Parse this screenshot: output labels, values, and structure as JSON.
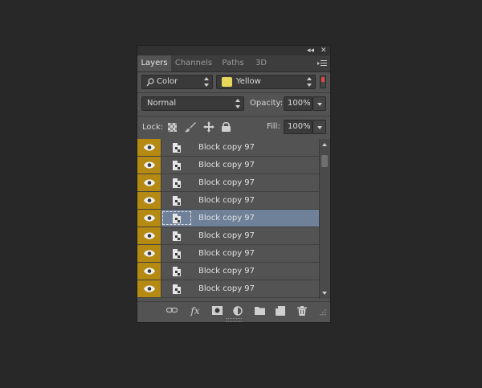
{
  "window": {
    "collapse_glyph": "◂◂",
    "close_glyph": "✕"
  },
  "tabs": [
    {
      "label": "Layers",
      "active": true
    },
    {
      "label": "Channels",
      "active": false
    },
    {
      "label": "Paths",
      "active": false
    },
    {
      "label": "3D",
      "active": false
    }
  ],
  "filter": {
    "kind_value": "Color",
    "color_value": "Yellow",
    "swatch_color": "#e8d65a",
    "toggle_color": "#e04848"
  },
  "blend": {
    "mode_value": "Normal",
    "opacity_label": "Opacity:",
    "opacity_value": "100%"
  },
  "lock": {
    "label": "Lock:",
    "fill_label": "Fill:",
    "fill_value": "100%"
  },
  "layers": [
    {
      "name": "Block copy 97",
      "selected": false
    },
    {
      "name": "Block copy 97",
      "selected": false
    },
    {
      "name": "Block copy 97",
      "selected": false
    },
    {
      "name": "Block copy 97",
      "selected": false
    },
    {
      "name": "Block copy 97",
      "selected": true
    },
    {
      "name": "Block copy 97",
      "selected": false
    },
    {
      "name": "Block copy 97",
      "selected": false
    },
    {
      "name": "Block copy 97",
      "selected": false
    },
    {
      "name": "Block copy 97",
      "selected": false
    }
  ],
  "colors": {
    "eye_column": "#b58a12",
    "selected_row": "#6f8198"
  },
  "bottom_icons": [
    "link-icon",
    "fx-icon",
    "mask-icon",
    "adjustment-icon",
    "folder-icon",
    "new-layer-icon",
    "trash-icon"
  ]
}
